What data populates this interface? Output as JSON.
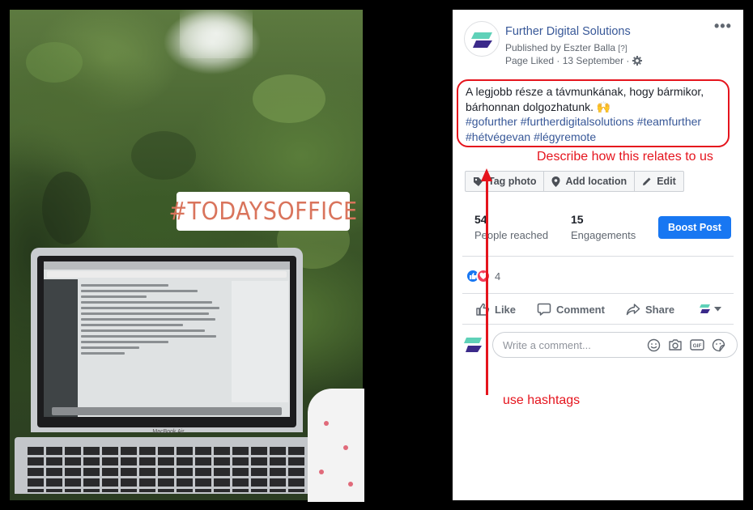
{
  "photo": {
    "sticker_text": "#TODAYSOFFICE",
    "laptop_label": "MacBook Air"
  },
  "post": {
    "page_name": "Further Digital Solutions",
    "published_by": "Published by Eszter Balla",
    "published_mark": "[?]",
    "meta_text": "Page Liked · 13 September ·",
    "more_label": "•••",
    "body_text": "A legjobb része a távmunkának, hogy bármikor, bárhonnan dolgozhatunk. 🙌",
    "hashtags": "#gofurther #furtherdigitalsolutions #teamfurther #hétvégevan #légyremote",
    "tools": {
      "tag_photo": "Tag photo",
      "add_location": "Add location",
      "edit": "Edit"
    },
    "stats": {
      "reached_value": "54",
      "reached_label": "People reached",
      "engagements_value": "15",
      "engagements_label": "Engagements"
    },
    "boost_label": "Boost Post",
    "reaction_count": "4",
    "actions": {
      "like": "Like",
      "comment": "Comment",
      "share": "Share"
    },
    "comment_placeholder": "Write a comment..."
  },
  "annotations": {
    "describe": "Describe how this relates to us",
    "hashtags": "use hashtags"
  },
  "colors": {
    "brand_link": "#385898",
    "boost_button": "#1877f2",
    "annotation_red": "#e5141d",
    "sticker_text": "#d9745c"
  },
  "icons": [
    "tag-icon",
    "location-pin-icon",
    "pencil-icon",
    "gear-icon",
    "like-reaction-icon",
    "love-reaction-icon",
    "thumbs-up-icon",
    "comment-bubble-icon",
    "share-arrow-icon",
    "chevron-down-icon",
    "emoji-icon",
    "camera-icon",
    "gif-icon",
    "sticker-icon"
  ]
}
